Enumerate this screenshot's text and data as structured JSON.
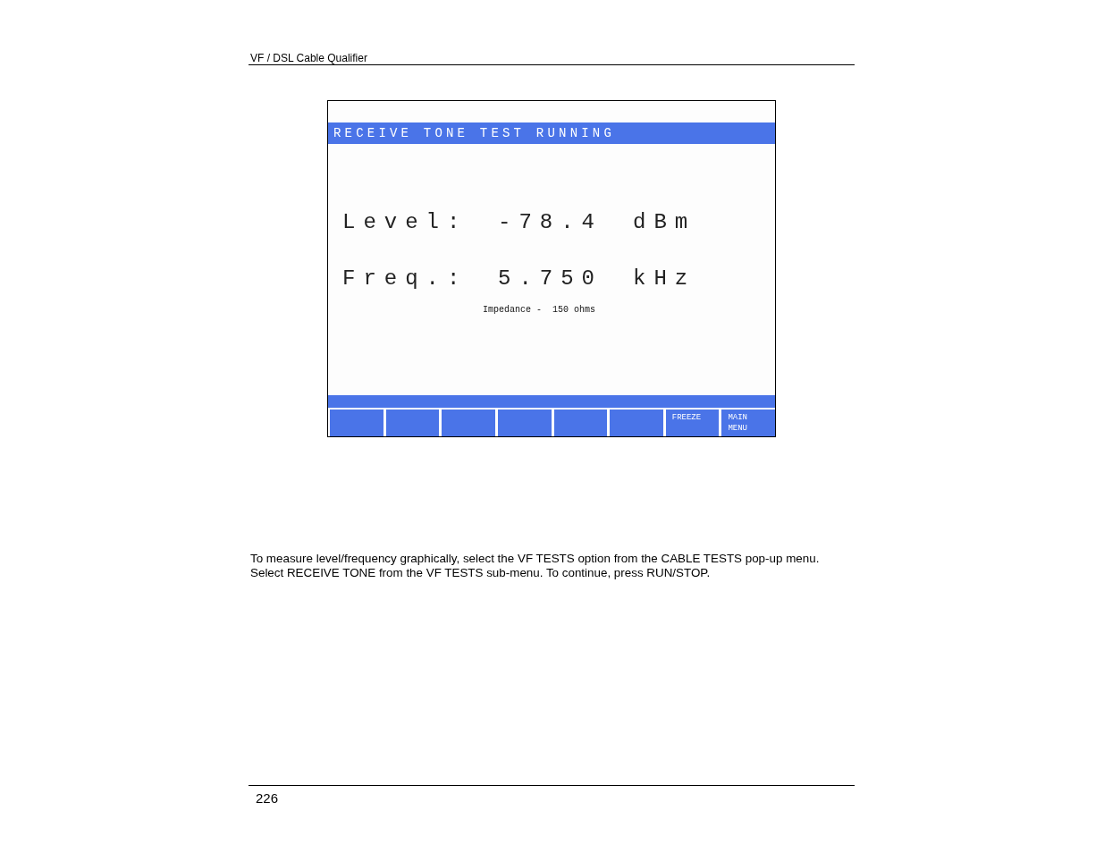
{
  "header": {
    "title": "VF / DSL Cable Qualifier"
  },
  "screen": {
    "title": "RECEIVE TONE TEST RUNNING",
    "readings": [
      {
        "label": "Level:",
        "value": "-78.4",
        "unit": "dBm"
      },
      {
        "label": "Freq.:",
        "value": "5.750",
        "unit": "kHz"
      }
    ],
    "note": "Impedance -  150 ohms",
    "softkeys": [
      {
        "kind": "blank"
      },
      {
        "kind": "blank"
      },
      {
        "kind": "blank"
      },
      {
        "kind": "blank"
      },
      {
        "kind": "blank"
      },
      {
        "kind": "blank"
      },
      {
        "kind": "labeled",
        "lines": [
          "FREEZE"
        ]
      },
      {
        "kind": "labeled",
        "lines": [
          "MAIN",
          "MENU"
        ]
      }
    ]
  },
  "body": [
    "To measure level/frequency graphically, select the VF TESTS option from the CABLE TESTS pop-up menu.",
    "Select RECEIVE TONE from the VF TESTS sub-menu. To continue, press RUN/STOP."
  ],
  "footer": {
    "page_number": "226"
  }
}
